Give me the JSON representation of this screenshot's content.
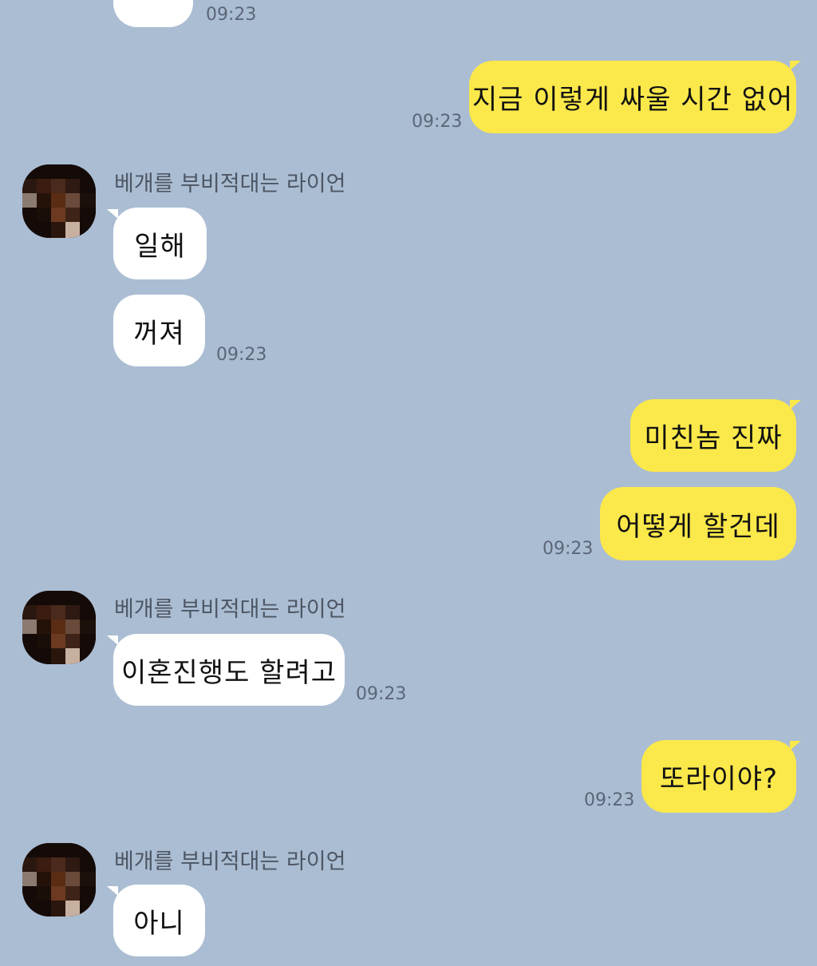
{
  "colors": {
    "background": "#abbdd3",
    "incoming_bubble": "#ffffff",
    "outgoing_bubble": "#fbe84a",
    "timestamp": "#5b6778",
    "sender_name": "#4d5664"
  },
  "messages": {
    "m0": {
      "direction": "incoming",
      "text": "",
      "time": "09:23"
    },
    "m1": {
      "direction": "outgoing",
      "text": "지금 이렇게 싸울 시간 없어",
      "time": "09:23"
    },
    "g1": {
      "sender": "베개를 부비적대는 라이언",
      "avatar": "blurred-avatar"
    },
    "m2": {
      "direction": "incoming",
      "text": "일해"
    },
    "m3": {
      "direction": "incoming",
      "text": "꺼져",
      "time": "09:23"
    },
    "m4": {
      "direction": "outgoing",
      "text": "미친놈 진짜"
    },
    "m5": {
      "direction": "outgoing",
      "text": "어떻게 할건데",
      "time": "09:23"
    },
    "g2": {
      "sender": "베개를 부비적대는 라이언",
      "avatar": "blurred-avatar"
    },
    "m6": {
      "direction": "incoming",
      "text": "이혼진행도 할려고",
      "time": "09:23"
    },
    "m7": {
      "direction": "outgoing",
      "text": "또라이야?",
      "time": "09:23"
    },
    "g3": {
      "sender": "베개를 부비적대는 라이언",
      "avatar": "blurred-avatar"
    },
    "m8": {
      "direction": "incoming",
      "text": "아니"
    }
  }
}
